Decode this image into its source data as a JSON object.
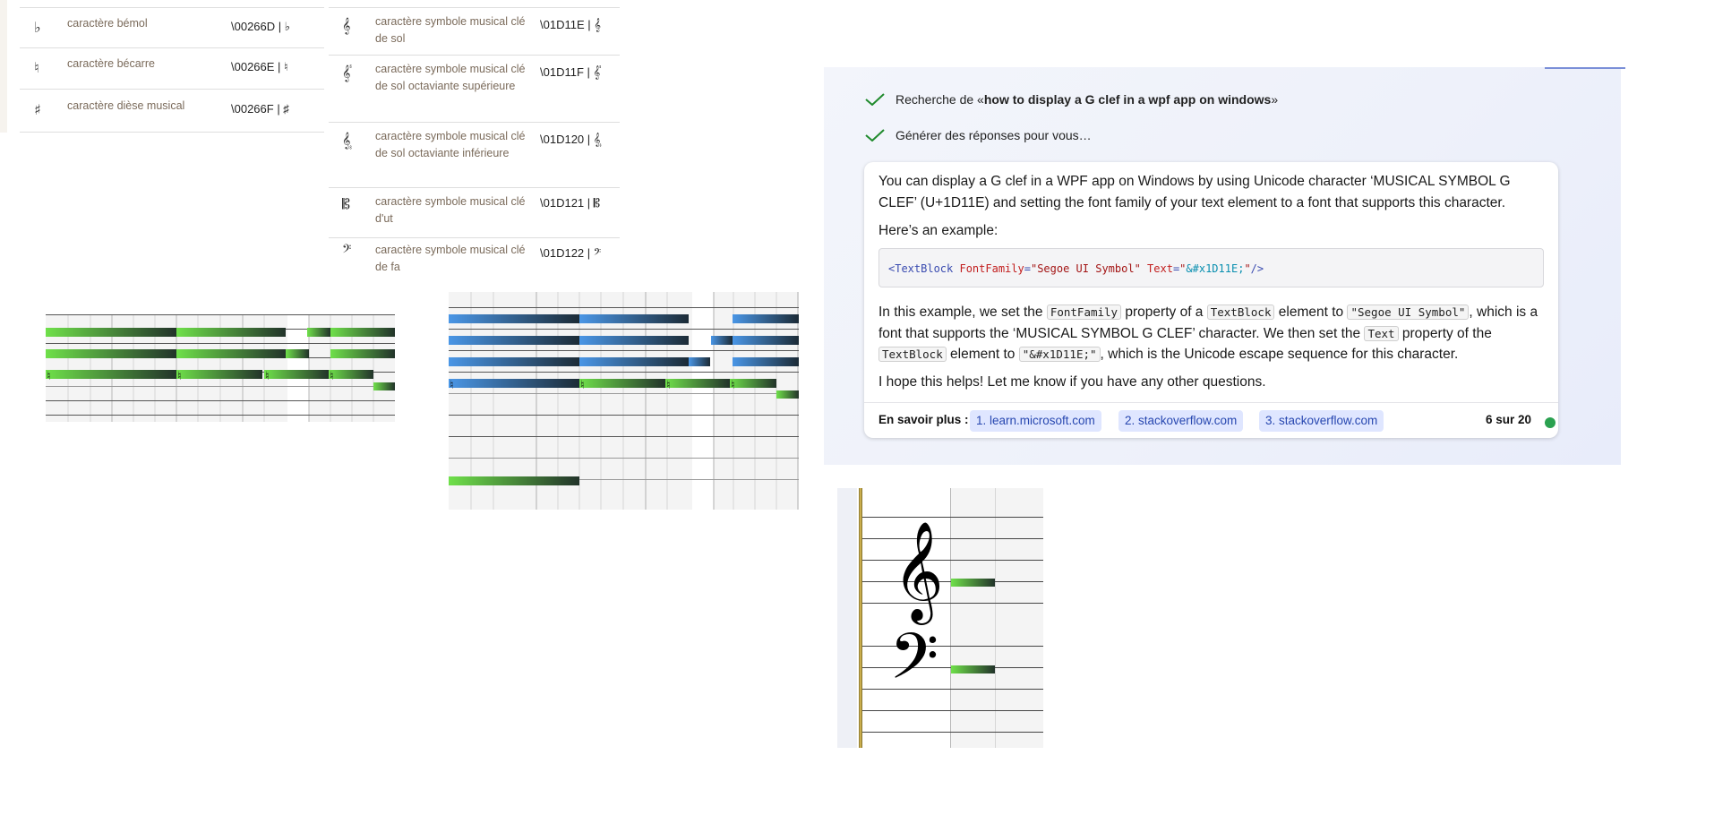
{
  "unicode_table": {
    "left_rows": [
      {
        "glyph": "♭",
        "name": "caractère bémol",
        "code": "\\00266D | ♭"
      },
      {
        "glyph": "♮",
        "name": "caractère bécarre",
        "code": "\\00266E | ♮"
      },
      {
        "glyph": "♯",
        "name": "caractère dièse musical",
        "code": "\\00266F | ♯"
      }
    ],
    "right_rows": [
      {
        "glyph": "𝄞",
        "name": "caractère symbole musical clé de sol",
        "code": "\\01D11E | 𝄞"
      },
      {
        "glyph": "𝄟",
        "name": "caractère symbole musical clé de sol octaviante supérieure",
        "code": "\\01D11F | 𝄟"
      },
      {
        "glyph": "𝄠",
        "name": "caractère symbole musical clé de sol octaviante inférieure",
        "code": "\\01D120 | 𝄠"
      },
      {
        "glyph": "𝄡",
        "name": "caractère symbole musical clé d'ut",
        "code": "\\01D121 | 𝄡"
      },
      {
        "glyph": "𝄢",
        "name": "caractère symbole musical clé de fa",
        "code": "\\01D122 | 𝄢"
      }
    ]
  },
  "rolls": {
    "natural_mark": "♮",
    "bar_color_green": "#5ccf3a",
    "bar_color_blue": "#3b86d6",
    "bar_color_dark": "#1f2f25"
  },
  "chat": {
    "step1_prefix": "Recherche de «",
    "step1_query": "how to display a G clef in a wpf app on windows",
    "step1_suffix": "»",
    "step2": "Générer des réponses pour vous…",
    "para1": "You can display a G clef in a WPF app on Windows by using Unicode character ‘MUSICAL SYMBOL G CLEF’ (U+1D11E) and setting the font family of your text element to a font that supports this character.",
    "para2": "Here’s an example:",
    "code": {
      "open": "<TextBlock",
      "attr1": "FontFamily",
      "eq": "=",
      "val1": "\"Segoe UI Symbol\"",
      "attr2": "Text",
      "q1": "\"",
      "esc": "&#x1D11E;",
      "q2": "\"",
      "close": "/>"
    },
    "para3": {
      "t1": "In this example, we set the ",
      "c1": "FontFamily",
      "t2": " property of a ",
      "c2": "TextBlock",
      "t3": " element to ",
      "c3": "\"Segoe UI Symbol\"",
      "t4": ", which is a font that supports the ‘MUSICAL SYMBOL G CLEF’ character. We then set the ",
      "c4": "Text",
      "t5": " property of the ",
      "c5": "TextBlock",
      "t6": " element to ",
      "c6": "\"&#x1D11E;\"",
      "t7": ", which is the Unicode escape sequence for this character."
    },
    "para4": "I hope this helps! Let me know if you have any other questions.",
    "learn_more": "En savoir plus :",
    "links": [
      "1. learn.microsoft.com",
      "2. stackoverflow.com",
      "3. stackoverflow.com"
    ],
    "counter": "6 sur 20",
    "status_color": "#2aa150"
  },
  "clef_staff": {
    "treble": "𝄞",
    "bass": "𝄢"
  }
}
